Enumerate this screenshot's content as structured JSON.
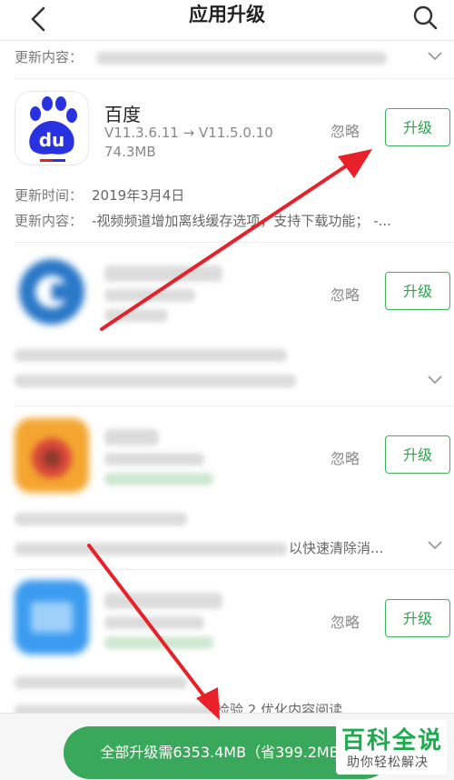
{
  "header": {
    "title": "应用升级"
  },
  "labels": {
    "update_content": "更新内容：",
    "update_time": "更新时间：",
    "ignore": "忽略",
    "upgrade": "升级"
  },
  "app": {
    "name": "百度",
    "version": "V11.3.6.11 → V11.5.0.10",
    "size": "74.3MB",
    "update_time": "2019年3月4日",
    "update_content": "-视频频道增加离线缓存选项，支持下载功能；  -..."
  },
  "app3": {
    "content_tail": "以快速清除消..."
  },
  "app4": {
    "content_tail": "检验  2.优化内容阅读"
  },
  "bottom": {
    "all_upgrade": "全部升级需6353.4MB（省399.2MB）"
  },
  "watermark": {
    "line1": "百科全说",
    "line2": "助你轻松解决"
  },
  "colors": {
    "accent": "#3aa85a",
    "arrow": "#e8202a"
  },
  "icons": [
    "back-arrow-icon",
    "search-icon",
    "chevron-down-icon",
    "baidu-app-icon"
  ]
}
